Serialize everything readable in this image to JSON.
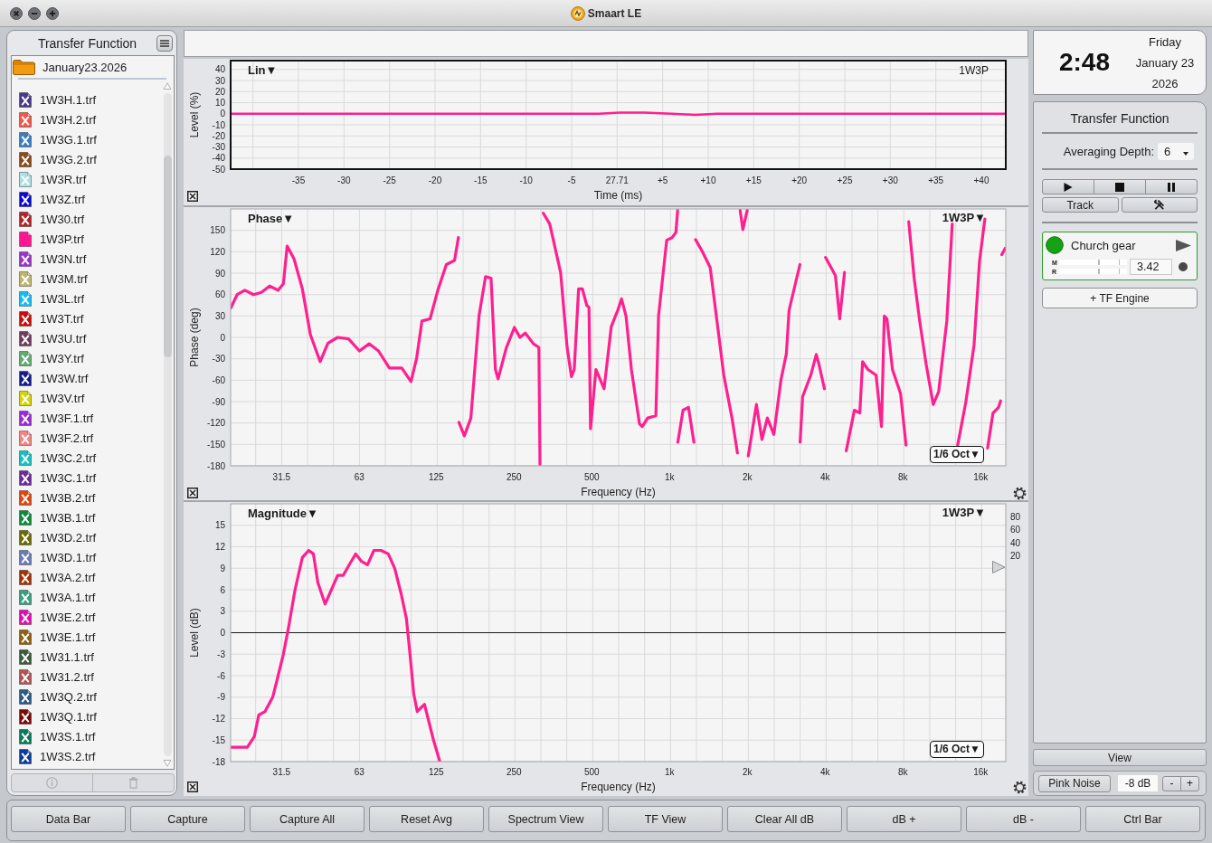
{
  "window": {
    "title": "Smaart LE"
  },
  "sidebar": {
    "title": "Transfer Function",
    "folder": "January23.2026",
    "files": [
      {
        "name": "1W3H.1.trf",
        "color": "#4a3a8a",
        "shown": false
      },
      {
        "name": "1W3H.2.trf",
        "color": "#f2584a",
        "shown": false
      },
      {
        "name": "1W3G.1.trf",
        "color": "#3b7ec0",
        "shown": false
      },
      {
        "name": "1W3G.2.trf",
        "color": "#8a4a1c",
        "shown": false
      },
      {
        "name": "1W3R.trf",
        "color": "#ade0e6",
        "shown": false
      },
      {
        "name": "1W3Z.trf",
        "color": "#0a0ad0",
        "shown": false
      },
      {
        "name": "1W30.trf",
        "color": "#b0242a",
        "shown": false
      },
      {
        "name": "1W3P.trf",
        "color": "#ff1493",
        "shown": true
      },
      {
        "name": "1W3N.trf",
        "color": "#9a35cc",
        "shown": false
      },
      {
        "name": "1W3M.trf",
        "color": "#bfb56e",
        "shown": false
      },
      {
        "name": "1W3L.trf",
        "color": "#12bdf5",
        "shown": false
      },
      {
        "name": "1W3T.trf",
        "color": "#cc0a0a",
        "shown": false
      },
      {
        "name": "1W3U.trf",
        "color": "#6e3d5e",
        "shown": false
      },
      {
        "name": "1W3Y.trf",
        "color": "#62aa72",
        "shown": false
      },
      {
        "name": "1W3W.trf",
        "color": "#161a8e",
        "shown": false
      },
      {
        "name": "1W3V.trf",
        "color": "#d6d400",
        "shown": false
      },
      {
        "name": "1W3F.1.trf",
        "color": "#9a2ad8",
        "shown": false
      },
      {
        "name": "1W3F.2.trf",
        "color": "#f38282",
        "shown": false
      },
      {
        "name": "1W3C.2.trf",
        "color": "#12c2c2",
        "shown": false
      },
      {
        "name": "1W3C.1.trf",
        "color": "#6a2a9c",
        "shown": false
      },
      {
        "name": "1W3B.2.trf",
        "color": "#e2440e",
        "shown": false
      },
      {
        "name": "1W3B.1.trf",
        "color": "#0e8a3c",
        "shown": false
      },
      {
        "name": "1W3D.2.trf",
        "color": "#6c6a06",
        "shown": false
      },
      {
        "name": "1W3D.1.trf",
        "color": "#6a7cb8",
        "shown": false
      },
      {
        "name": "1W3A.2.trf",
        "color": "#a2320a",
        "shown": false
      },
      {
        "name": "1W3A.1.trf",
        "color": "#3c9e80",
        "shown": false
      },
      {
        "name": "1W3E.2.trf",
        "color": "#e00eb2",
        "shown": false
      },
      {
        "name": "1W3E.1.trf",
        "color": "#8c6212",
        "shown": false
      },
      {
        "name": "1W31.1.trf",
        "color": "#3c5a3c",
        "shown": false
      },
      {
        "name": "1W31.2.trf",
        "color": "#b05454",
        "shown": false
      },
      {
        "name": "1W3Q.2.trf",
        "color": "#2c5a80",
        "shown": false
      },
      {
        "name": "1W3Q.1.trf",
        "color": "#7a0a0a",
        "shown": false
      },
      {
        "name": "1W3S.1.trf",
        "color": "#0a7a5c",
        "shown": false
      },
      {
        "name": "1W3S.2.trf",
        "color": "#0c3c9a",
        "shown": false
      }
    ]
  },
  "charts": [
    {
      "kind": "impulse",
      "mode": "Lin▼",
      "trace": "1W3P",
      "center_time": "27.71",
      "chart_data": {
        "type": "line",
        "xlabel": "Time (ms)",
        "ylabel": "Level (%)",
        "grid": true,
        "x": [
          -42.45,
          -35,
          -28,
          -20,
          -12,
          -6,
          -2,
          0.3,
          3,
          6,
          8.6,
          11,
          15,
          20,
          25,
          30,
          36,
          42.68
        ],
        "series": [
          {
            "color": "#ff1f8e",
            "values": [
              0,
              0,
              0,
              0,
              0,
              0,
              0,
              1,
              1,
              0,
              -1,
              0,
              0,
              0,
              0,
              0,
              0,
              0
            ]
          }
        ],
        "xlim": [
          -42.45,
          42.68
        ],
        "ylim": [
          -50,
          48
        ],
        "xticks": [
          -35,
          -30,
          -25,
          -20,
          -15,
          -10,
          -5,
          {
            "value": 5,
            "label": "+5"
          },
          {
            "value": 10,
            "label": "+10"
          },
          {
            "value": 15,
            "label": "+15"
          },
          {
            "value": 20,
            "label": "+20"
          },
          {
            "value": 25,
            "label": "+25"
          },
          {
            "value": 30,
            "label": "+30"
          },
          {
            "value": 35,
            "label": "+35"
          },
          {
            "value": 40,
            "label": "+40"
          }
        ],
        "yticks": [
          40,
          30,
          20,
          10,
          0,
          -10,
          -20,
          -30,
          -40,
          -50
        ]
      }
    },
    {
      "kind": "phase",
      "mode": "Phase▼",
      "trace": "1W3P▼",
      "smoothing": "1/6 Oct▼",
      "chart_data": {
        "type": "line",
        "xlabel": "Frequency (Hz)",
        "ylabel": "Phase (deg)",
        "grid": true,
        "log": "x",
        "x": [
          20,
          21.2,
          22.7,
          24.5,
          26.3,
          28.3,
          30.5,
          32,
          33.1,
          35.2,
          37.9,
          40.7,
          44.4,
          47.6,
          51.9,
          57.2,
          63,
          68.7,
          74.7,
          82.3,
          91.9,
          99.8,
          104.8,
          110,
          118.3,
          127.2,
          136.8,
          147.2,
          152.2,
          153,
          160.6,
          170.2,
          183,
          193.9,
          203.6,
          211.6,
          216.8,
          233.2,
          250.8,
          263.3,
          276.3,
          297.2,
          312,
          315,
          324.4,
          343.7,
          378.6,
          401.3,
          417,
          427.5,
          444.2,
          459.6,
          477.9,
          487.3,
          494.3,
          518.8,
          557.9,
          594.4,
          630,
          651.7,
          677.6,
          711.3,
          764.5,
          783.4,
          822.2,
          884.2,
          905.9,
          974.3,
          1022.8,
          1058,
          1074,
          1076,
          1127,
          1183,
          1241.7,
          1260,
          1335.6,
          1435.5,
          1543.8,
          1620.7,
          1742.9,
          1829.5,
          1874.6,
          1920.6,
          1996.5,
          2016,
          2168,
          2276,
          2389,
          2532,
          2697,
          2831,
          2899,
          3194,
          3200,
          3273,
          3519,
          3695,
          3786,
          3972,
          4013,
          4379,
          4552,
          4753,
          4826,
          5188,
          5446,
          5582,
          5853,
          6297,
          6609,
          6773,
          6936,
          7283,
          7834,
          8222,
          8423,
          8842,
          9283,
          9837,
          10480,
          11000,
          11825,
          12411,
          13028,
          14011,
          15066,
          15816,
          16604,
          17013,
          17857,
          18749,
          19100,
          19300,
          19900
        ],
        "series": [
          {
            "color": "#ff1f8e",
            "values": [
              41,
              60,
              66,
              60,
              63,
              72,
              66,
              75,
              128,
              110,
              68,
              4,
              -34,
              -8,
              0,
              -2,
              -19,
              -9,
              -19,
              -43,
              -43,
              -62,
              -30,
              23,
              26,
              68,
              102,
              108,
              140,
              -119,
              -138,
              -113,
              30,
              85,
              83,
              -45,
              -58,
              -15,
              14,
              0,
              6,
              -9,
              -14,
              -178,
              174,
              159,
              91,
              -15,
              -55,
              -45,
              68,
              68,
              45,
              42,
              -128,
              -45,
              -72,
              15,
              38,
              54,
              30,
              -45,
              -121,
              -125,
              -113,
              -110,
              30,
              136,
              140,
              147,
              178,
              -147,
              -102,
              -98,
              -147,
              137,
              121,
              98,
              8,
              -53,
              -113,
              -162,
              178,
              151,
              178,
              -166,
              -94,
              -143,
              -113,
              -136,
              -60,
              -23,
              38,
              102,
              -147,
              -83,
              -53,
              -24,
              -38,
              -72,
              112,
              87,
              26,
              91,
              -159,
              -102,
              -106,
              -34,
              -45,
              -53,
              -125,
              30,
              26,
              -45,
              -79,
              -151,
              162,
              83,
              23,
              -38,
              -94,
              -76,
              23,
              159,
              -151,
              -91,
              -11,
              106,
              166,
              -155,
              -106,
              -98,
              -89,
              116,
              125
            ]
          }
        ],
        "xlim": [
          20,
          20000
        ],
        "ylim": [
          -180,
          180
        ],
        "xticks": [
          31.5,
          63,
          125,
          250,
          500,
          {
            "value": 1000,
            "label": "1k"
          },
          {
            "value": 2000,
            "label": "2k"
          },
          {
            "value": 4000,
            "label": "4k"
          },
          {
            "value": 8000,
            "label": "8k"
          },
          {
            "value": 16000,
            "label": "16k"
          }
        ],
        "yticks": [
          150,
          120,
          90,
          60,
          30,
          0,
          -30,
          -60,
          -90,
          -120,
          -150,
          -180
        ]
      }
    },
    {
      "kind": "magnitude",
      "mode": "Magnitude▼",
      "trace": "1W3P▼",
      "smoothing": "1/6 Oct▼",
      "right_scale": [
        "80",
        "60",
        "40",
        "20"
      ],
      "chart_data": {
        "type": "line",
        "xlabel": "Frequency (Hz)",
        "ylabel": "Level (dB)",
        "grid": true,
        "log": "x",
        "x": [
          20,
          21.4,
          23.2,
          24.7,
          25.7,
          27.2,
          29.1,
          30.3,
          32,
          33.6,
          35.5,
          37.9,
          40.1,
          41.8,
          43.5,
          46.4,
          49.1,
          51.9,
          54.5,
          57.6,
          61,
          64,
          67.7,
          71.7,
          76.4,
          81.5,
          86.3,
          91.3,
          95.8,
          98.9,
          102.2,
          105.5,
          112.5,
          116.2,
          122,
          129
        ],
        "series": [
          {
            "color": "#ff1f8e",
            "values": [
              -16,
              -16,
              -16,
              -14.5,
              -11.5,
              -11,
              -9,
              -6.5,
              -3,
              1,
              6,
              10.5,
              11.5,
              11,
              7,
              4,
              6,
              8,
              8,
              9.5,
              11,
              10,
              9.5,
              11.5,
              11.5,
              11,
              9,
              5.5,
              2,
              -3,
              -8.5,
              -11,
              -10,
              -12,
              -15,
              -18
            ]
          }
        ],
        "xlim": [
          20,
          20000
        ],
        "ylim": [
          -18,
          18
        ],
        "xticks": [
          31.5,
          63,
          125,
          250,
          500,
          {
            "value": 1000,
            "label": "1k"
          },
          {
            "value": 2000,
            "label": "2k"
          },
          {
            "value": 4000,
            "label": "4k"
          },
          {
            "value": 8000,
            "label": "8k"
          },
          {
            "value": 16000,
            "label": "16k"
          }
        ],
        "yticks": [
          15,
          12,
          9,
          6,
          3,
          0,
          -3,
          -6,
          -9,
          -12,
          -15,
          -18
        ]
      }
    }
  ],
  "clock": {
    "time": "2:48",
    "day": "Friday",
    "date": "January 23",
    "year": "2026"
  },
  "control_panel": {
    "title": "Transfer Function",
    "averaging_label": "Averaging Depth:",
    "averaging_value": "6",
    "track_button": "Track",
    "measurement": {
      "name": "Church gear",
      "active": true,
      "meters": [
        {
          "label": "M",
          "level": 0
        },
        {
          "label": "R",
          "level": 0
        }
      ],
      "delay": "3.42"
    },
    "add_button": "+ TF Engine"
  },
  "view_button": "View",
  "generator": {
    "button": "Pink Noise",
    "level": "-8 dB",
    "minus": "-",
    "plus": "+"
  },
  "bottom_bar": [
    "Data Bar",
    "Capture",
    "Capture All",
    "Reset Avg",
    "Spectrum View",
    "TF View",
    "Clear All dB",
    "dB +",
    "dB -",
    "Ctrl Bar"
  ]
}
